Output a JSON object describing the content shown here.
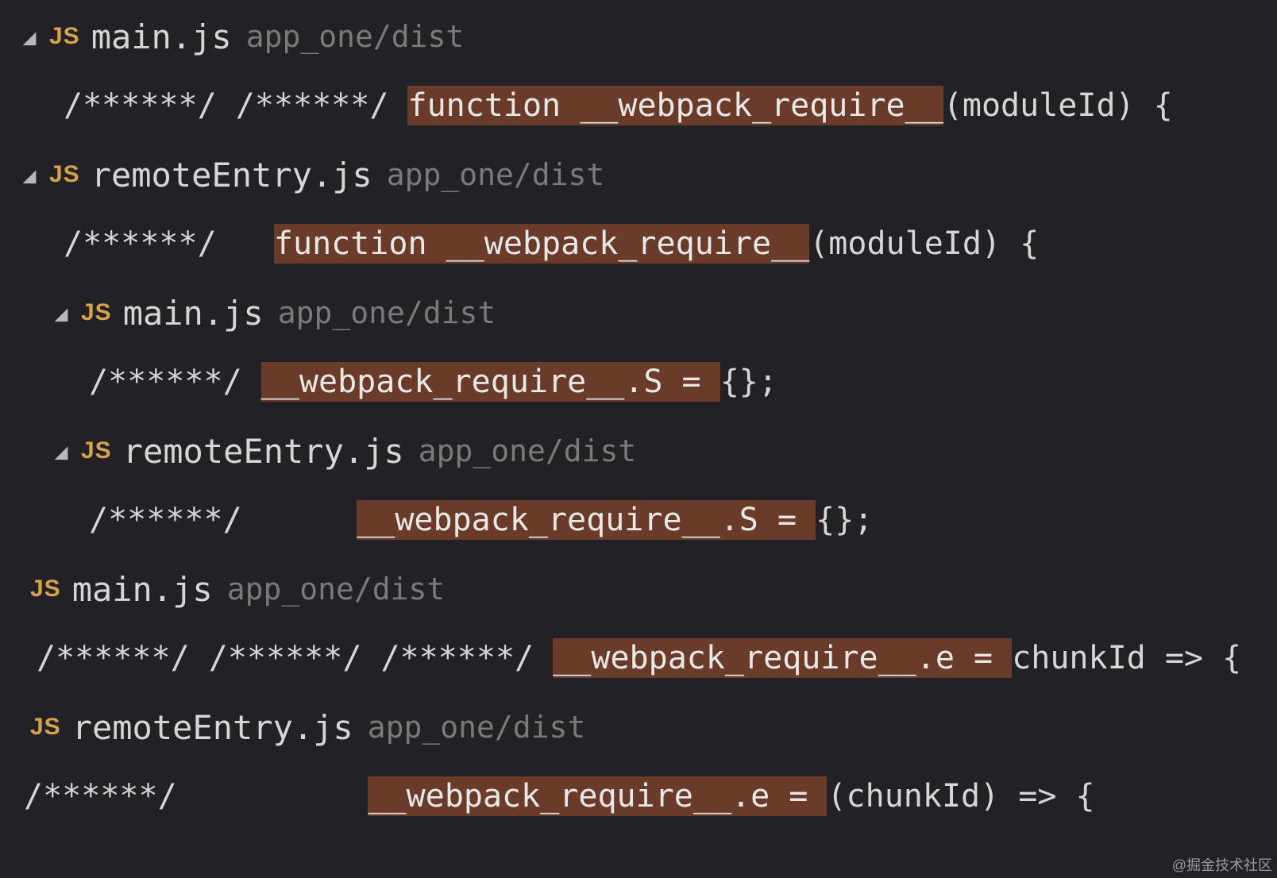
{
  "icons": {
    "js": "JS",
    "chevron_down": "◢"
  },
  "results": [
    {
      "file": "main.js",
      "path": "app_one/dist",
      "row_variant": "base",
      "show_arrow": true,
      "code_variant": "base",
      "code": {
        "pre": "/******/ /******/ ",
        "hl": "function __webpack_require__",
        "post": "(moduleId) {"
      }
    },
    {
      "file": "remoteEntry.js",
      "path": "app_one/dist",
      "row_variant": "base",
      "show_arrow": true,
      "code_variant": "base",
      "code": {
        "pre": "/******/   ",
        "hl": "function __webpack_require__",
        "post": "(moduleId) {"
      }
    },
    {
      "file": "main.js",
      "path": "app_one/dist",
      "row_variant": "indent",
      "show_arrow": true,
      "code_variant": "indent",
      "code": {
        "pre": "/******/ ",
        "hl": "__webpack_require__.S = ",
        "post": "{};"
      }
    },
    {
      "file": "remoteEntry.js",
      "path": "app_one/dist",
      "row_variant": "indent",
      "show_arrow": true,
      "code_variant": "indent",
      "code": {
        "pre": "/******/      ",
        "hl": "__webpack_require__.S = ",
        "post": "{};"
      }
    },
    {
      "file": "main.js",
      "path": "app_one/dist",
      "row_variant": "no-arrow",
      "show_arrow": false,
      "code_variant": "deep",
      "code": {
        "pre": "/******/ /******/ /******/ ",
        "hl": "__webpack_require__.e = ",
        "post": "chunkId => {"
      }
    },
    {
      "file": "remoteEntry.js",
      "path": "app_one/dist",
      "row_variant": "no-arrow",
      "show_arrow": false,
      "code_variant": "remote2",
      "code": {
        "pre": "/******/          ",
        "hl": "__webpack_require__.e = ",
        "post": "(chunkId) => {"
      }
    }
  ],
  "watermark": "@掘金技术社区"
}
